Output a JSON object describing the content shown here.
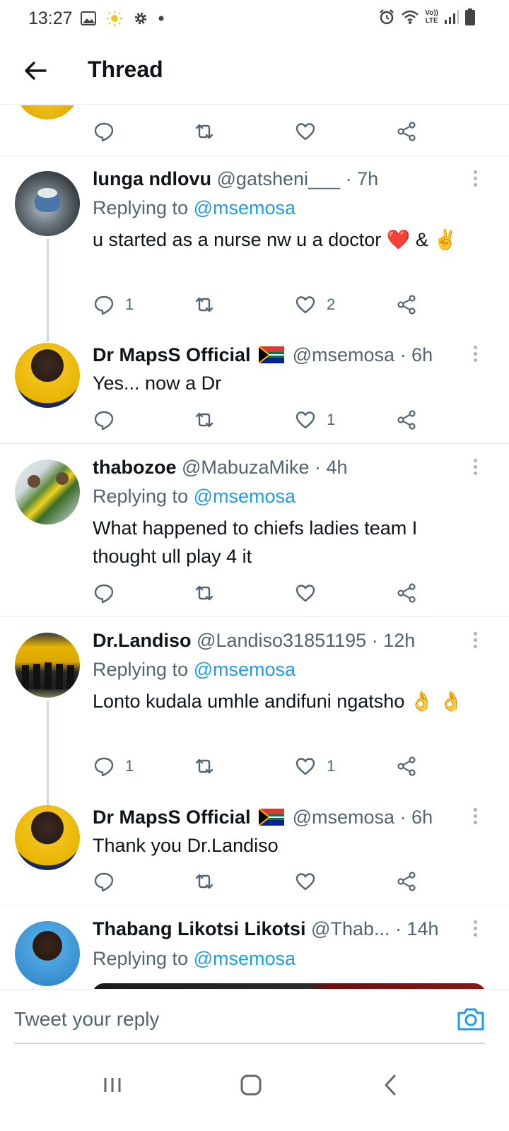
{
  "status_bar": {
    "time": "13:27",
    "lte_top": "Vo))",
    "lte_bottom": "LTE",
    "icons": [
      "image-icon",
      "sun-icon",
      "gear-icon",
      "dot-icon",
      "alarm-icon",
      "wifi-icon",
      "signal-icon",
      "battery-icon"
    ]
  },
  "header": {
    "title": "Thread"
  },
  "tweets": [
    {
      "avatar": "avatar-partial",
      "actions": {
        "reply": "",
        "retweet": "",
        "like": ""
      }
    },
    {
      "name": "lunga ndlovu",
      "handle": "@gatsheni___",
      "time": "· 7h",
      "replying_prefix": "Replying to ",
      "replying_to": "@msemosa",
      "text": "u started as a nurse nw u a doctor ❤️ & ✌️",
      "actions": {
        "reply": "1",
        "retweet": "",
        "like": "2"
      }
    },
    {
      "name": "Dr MapsS Official",
      "handle": "@msemosa",
      "time": "· 6h",
      "text": "Yes... now a Dr",
      "actions": {
        "reply": "",
        "retweet": "",
        "like": "1"
      }
    },
    {
      "name": "thabozoe",
      "handle": "@MabuzaMike",
      "time": "· 4h",
      "replying_prefix": "Replying to ",
      "replying_to": "@msemosa",
      "text": "What happened to chiefs ladies team I thought ull play 4 it",
      "actions": {
        "reply": "",
        "retweet": "",
        "like": ""
      }
    },
    {
      "name": "Dr.Landiso",
      "handle": "@Landiso31851195",
      "time": "· 12h",
      "replying_prefix": "Replying to ",
      "replying_to": "@msemosa",
      "text": "Lonto kudala umhle andifuni ngatsho 👌 👌",
      "actions": {
        "reply": "1",
        "retweet": "",
        "like": "1"
      }
    },
    {
      "name": "Dr MapsS Official",
      "handle": "@msemosa",
      "time": "· 6h",
      "text": "Thank you Dr.Landiso",
      "actions": {
        "reply": "",
        "retweet": "",
        "like": ""
      }
    },
    {
      "name": "Thabang Likotsi Likotsi",
      "handle": "@Thab...",
      "time": "· 14h",
      "replying_prefix": "Replying to ",
      "replying_to": "@msemosa"
    }
  ],
  "reply_bar": {
    "placeholder": "Tweet your reply"
  },
  "colors": {
    "accent": "#1d9bf0",
    "secondary_text": "#536471",
    "divider": "#e6ecf0"
  }
}
